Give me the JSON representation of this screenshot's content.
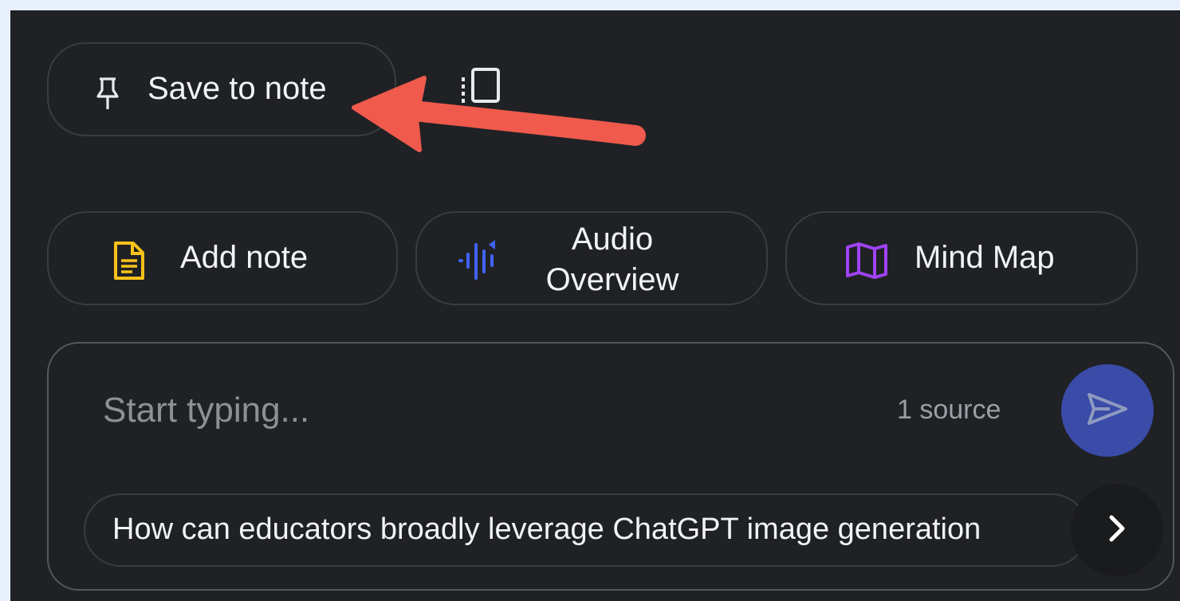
{
  "toolbar": {
    "save_to_note_label": "Save to note",
    "save_icon": "pin-icon",
    "copy_icon": "copy-icon"
  },
  "actions": [
    {
      "label": "Add note",
      "icon": "note-doc-icon",
      "color": "#f9c21a"
    },
    {
      "label_line1": "Audio",
      "label_line2": "Overview",
      "icon": "audio-waveform-icon",
      "color": "#3f63f5"
    },
    {
      "label": "Mind Map",
      "icon": "map-icon",
      "color": "#a142f4"
    }
  ],
  "chat": {
    "placeholder": "Start typing...",
    "source_count": "1 source",
    "send_icon": "send-icon",
    "suggestion": "How can educators broadly leverage ChatGPT image generation",
    "next_icon": "chevron-right-icon"
  },
  "annotation": {
    "arrow_color": "#ef5a4c"
  }
}
